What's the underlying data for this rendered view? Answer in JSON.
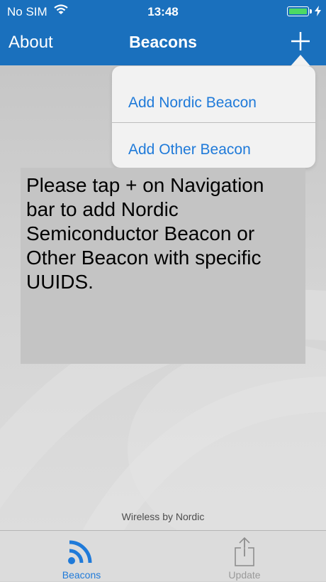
{
  "status_bar": {
    "carrier": "No SIM",
    "time": "13:48",
    "battery_level": 1.0
  },
  "nav": {
    "left_button": "About",
    "title": "Beacons",
    "right_icon": "plus-icon"
  },
  "popover_menu": {
    "items": [
      {
        "label": "Add Nordic Beacon"
      },
      {
        "label": "Add Other Beacon"
      }
    ]
  },
  "main": {
    "info_text": "Please tap + on Navigation bar to add Nordic Semiconductor Beacon or Other Beacon with specific UUIDS.",
    "footer_brand": "Wireless by Nordic"
  },
  "tab_bar": {
    "tabs": [
      {
        "label": "Beacons",
        "icon": "beacon-signal-icon",
        "selected": true
      },
      {
        "label": "Update",
        "icon": "share-upload-icon",
        "selected": false
      }
    ]
  },
  "colors": {
    "nav_bar": "#1a70bd",
    "accent": "#1f7ad9",
    "battery": "#4cd964"
  }
}
